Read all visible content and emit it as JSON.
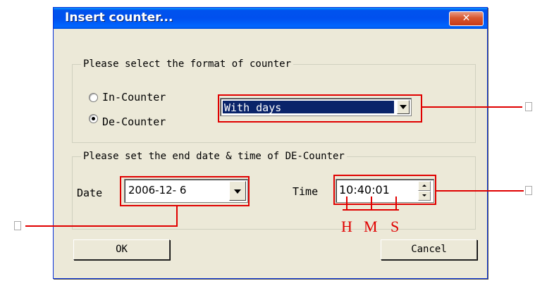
{
  "dialog": {
    "title": "Insert counter...",
    "close_label": "✕"
  },
  "format_group": {
    "label": "Please select the format of counter",
    "radios": [
      {
        "label": "In-Counter",
        "selected": false
      },
      {
        "label": "De-Counter",
        "selected": true
      }
    ],
    "format_select": {
      "value": "With days"
    }
  },
  "end_group": {
    "label": "Please set the end date & time of DE-Counter",
    "date_label": "Date",
    "date_value": "2006-12- 6",
    "time_label": "Time",
    "time_value": "10:40:01"
  },
  "buttons": {
    "ok": "OK",
    "cancel": "Cancel"
  },
  "annotations": {
    "hour": "H",
    "minute": "M",
    "second": "S",
    "callout_date": "",
    "callout_format": "",
    "callout_time": "",
    "color": "#e00000"
  },
  "colors": {
    "title_bar": "#0054e3",
    "dialog_bg": "#ece9d8",
    "selection": "#0a246a"
  }
}
